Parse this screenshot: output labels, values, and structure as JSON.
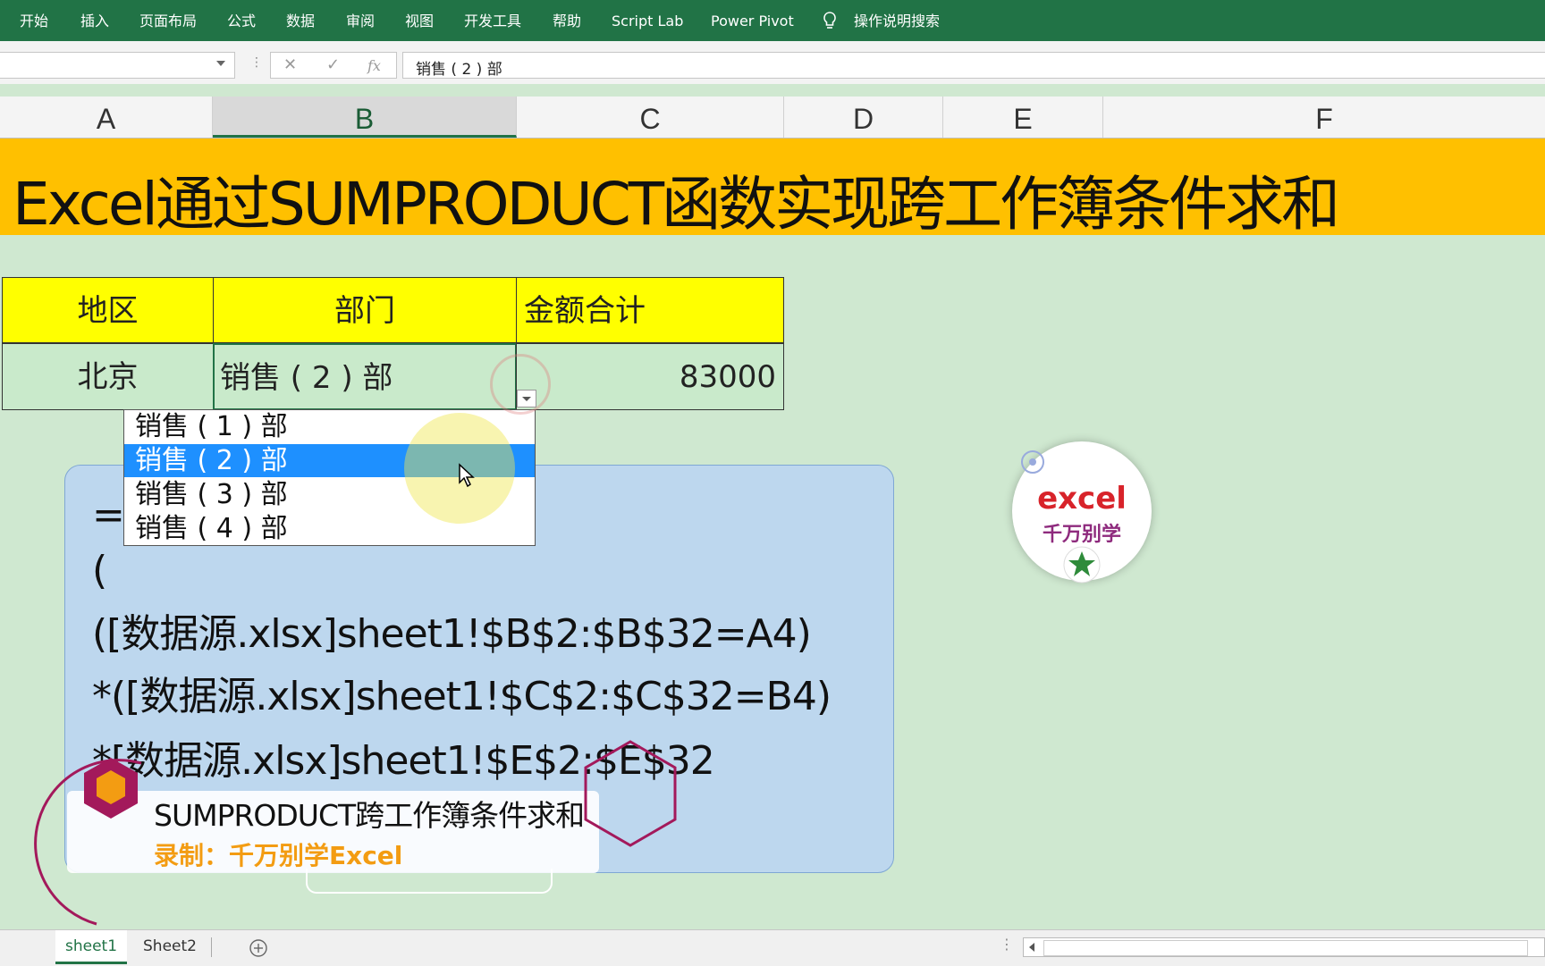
{
  "ribbon": {
    "tabs": [
      "开始",
      "插入",
      "页面布局",
      "公式",
      "数据",
      "审阅",
      "视图",
      "开发工具",
      "帮助",
      "Script Lab",
      "Power Pivot"
    ],
    "search_label": "操作说明搜索"
  },
  "formula_bar": {
    "cancel_glyph": "✕",
    "enter_glyph": "✓",
    "fx_glyph": "fx",
    "value": "销售 ( 2 ) 部"
  },
  "columns": [
    "A",
    "B",
    "C",
    "D",
    "E",
    "F"
  ],
  "title": "Excel通过SUMPRODUCT函数实现跨工作簿条件求和",
  "table": {
    "headers": [
      "地区",
      "部门",
      "金额合计"
    ],
    "row": {
      "region": "北京",
      "department": "销售 ( 2 ) 部",
      "amount": "83000"
    }
  },
  "dropdown": {
    "options": [
      "销售 ( 1 ) 部",
      "销售 ( 2 ) 部",
      "销售 ( 3 ) 部",
      "销售 ( 4 ) 部"
    ],
    "selected_index": 1
  },
  "formula_panel": {
    "lines": [
      "=S",
      "(",
      "([数据源.xlsx]sheet1!$B$2:$B$32=A4)",
      "*([数据源.xlsx]sheet1!$C$2:$C$32=B4)",
      "*[数据源.xlsx]sheet1!$E$2:$E$32"
    ]
  },
  "caption": {
    "title": "SUMPRODUCT跨工作簿条件求和",
    "subtitle": "录制：千万别学Excel"
  },
  "logo": {
    "text_top": "excel",
    "text_bottom": "千万别学"
  },
  "sheets": [
    "sheet1",
    "Sheet2"
  ],
  "active_sheet": "sheet1",
  "colors": {
    "ribbon": "#217346",
    "title_band": "#ffc000",
    "header_fill": "#ffff00",
    "data_fill": "#c9eacb",
    "panel": "#bdd7ee",
    "selected_option": "#1e90ff",
    "caption_accent": "#f39c12",
    "caption_ring": "#a3195b"
  }
}
